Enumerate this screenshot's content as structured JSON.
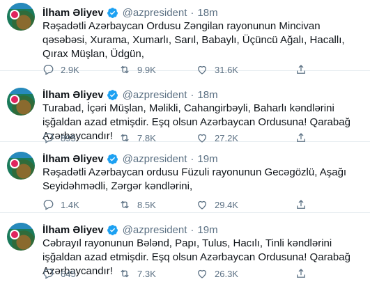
{
  "tweets": [
    {
      "author": "İlham Əliyev",
      "handle": "@azpresident",
      "separator": "·",
      "time": "18m",
      "text": "Rəşadətli Azərbaycan Ordusu Zəngilan rayonunun Mincivan qəsəbəsi, Xurama, Xumarlı, Sarıl, Babaylı, Üçüncü Ağalı, Hacallı, Qırax Müşlan, Üdgün,",
      "replies": "2.9K",
      "retweets": "9.9K",
      "likes": "31.6K"
    },
    {
      "author": "İlham Əliyev",
      "handle": "@azpresident",
      "separator": "·",
      "time": "18m",
      "text": "Turabad, İçəri Müşlan, Məlikli, Cahangirbəyli, Baharlı kəndlərini işğaldan azad etmişdir. Eşq olsun Azərbaycan Ordusuna! Qarabağ Azərbaycandır!",
      "replies": "895",
      "retweets": "7.8K",
      "likes": "27.2K"
    },
    {
      "author": "İlham Əliyev",
      "handle": "@azpresident",
      "separator": "·",
      "time": "19m",
      "text": "Rəşadətli Azərbaycan ordusu Füzuli rayonunun Gecəgözlü, Aşağı Seyidəhmədli, Zərgər kəndlərini,",
      "replies": "1.4K",
      "retweets": "8.5K",
      "likes": "29.4K"
    },
    {
      "author": "İlham Əliyev",
      "handle": "@azpresident",
      "separator": "·",
      "time": "19m",
      "text": "Cəbrayıl rayonunun Bələnd, Papı, Tulus, Hacılı, Tinli kəndlərini işğaldan azad etmişdir. Eşq olsun Azərbaycan Ordusuna! Qarabağ Azərbaycandır!",
      "replies": "645",
      "retweets": "7.3K",
      "likes": "26.3K"
    }
  ],
  "icons": {
    "verified": "verified-badge-icon",
    "reply": "reply-icon",
    "retweet": "retweet-icon",
    "like": "heart-icon",
    "share": "share-icon"
  },
  "colors": {
    "verified": "#1da1f2",
    "secondary_text": "#5b7083",
    "divider": "#e6ecf0"
  }
}
